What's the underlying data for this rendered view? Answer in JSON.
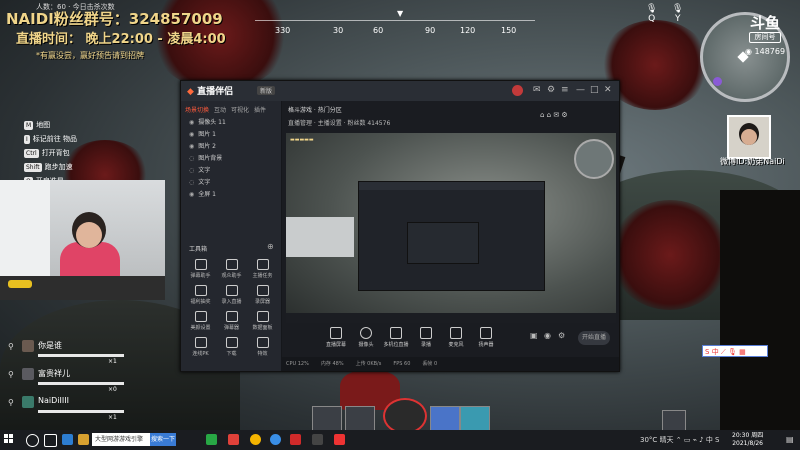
{
  "stream_overlay": {
    "top_small": "人数：60 · 今日击杀次数",
    "fan_group": "NAIDI粉丝群号：324857009",
    "live_time": "直播时间： 晚上22:00 - 凌晨4:00",
    "notice": "*有赢没尝，赢好预告请到招牌",
    "weibo": "微博ID:奶弟NaiDi",
    "brand": "斗鱼",
    "brand_sub": "房间号",
    "room_id": "148769"
  },
  "compass": {
    "marks": [
      "330",
      "30",
      "60",
      "90",
      "120",
      "150"
    ]
  },
  "hud": {
    "key_q": "Q",
    "key_y": "Y",
    "keys": [
      {
        "key": "M",
        "label": "地图"
      },
      {
        "key": "I",
        "label": "标记前往 物品"
      },
      {
        "key": "Ctrl",
        "label": "打开背包"
      },
      {
        "key": "Shift",
        "label": "跑步加速"
      },
      {
        "key": "Q",
        "label": "开启准星"
      }
    ]
  },
  "app": {
    "title": "直播伴侣",
    "badge": "新版",
    "tabs": [
      "场景切换",
      "互动",
      "可视化",
      "插件"
    ],
    "scenes": [
      "摄像头 11",
      "图片 1",
      "图片 2",
      "图片背景",
      "文字",
      "文字",
      "全屏 1"
    ],
    "tools_title": "工具箱",
    "tools": [
      "弹幕助手",
      "观众助手",
      "主播任务",
      "福利抽奖",
      "录入直播",
      "录屏器",
      "美颜设置",
      "弹幕器",
      "数据面板",
      "连线PK",
      "下载",
      "特效"
    ],
    "info_line1": "格斗游戏 · 热门分区",
    "info_line2": "直播管理 · 主播设置 · 粉丝数 414576",
    "controls": [
      "直播屏幕",
      "摄像头",
      "多机位直播",
      "录播",
      "麦克风",
      "扬声器"
    ],
    "start": "开始直播",
    "status": [
      "CPU 12%",
      "内存 48%",
      "上传 0KB/s",
      "FPS 60",
      "丢帧 0"
    ]
  },
  "squad": [
    {
      "name": "你是谁",
      "count": "1"
    },
    {
      "name": "富贵祥儿",
      "count": "0"
    },
    {
      "name": "NaiDiIIII",
      "count": "1"
    }
  ],
  "ime": {
    "label": "中"
  },
  "taskbar": {
    "search_placeholder": "大型网游游戏引擎",
    "search_button": "搜索一下",
    "temp": "30°C 晴天",
    "time": "20:30 周四",
    "date": "2021/8/26"
  }
}
